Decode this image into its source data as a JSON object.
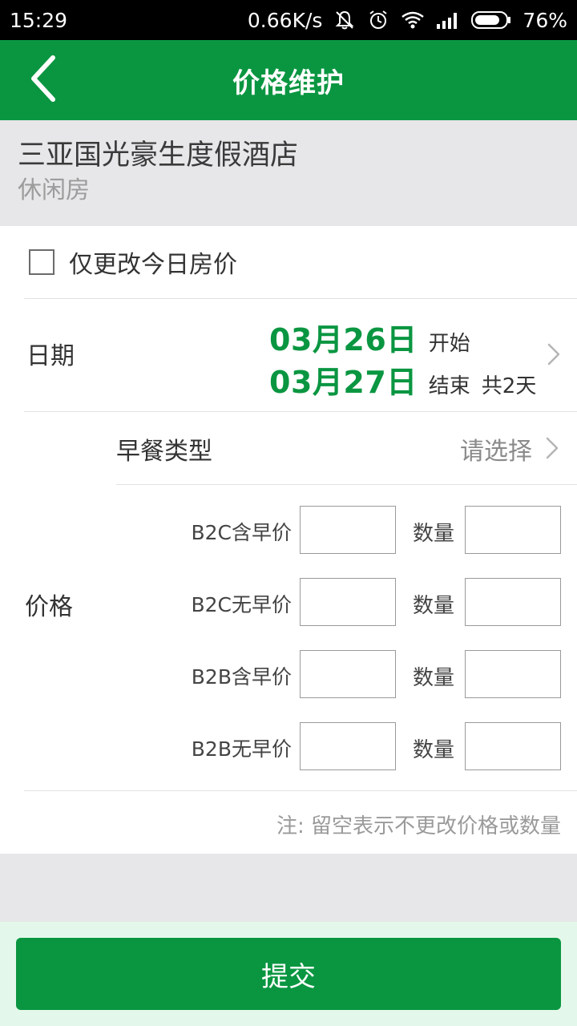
{
  "status_bar": {
    "time": "15:29",
    "speed": "0.66K/s",
    "battery": "76%"
  },
  "app_bar": {
    "title": "价格维护",
    "back_icon": "back-chevron-icon"
  },
  "hotel": {
    "name": "三亚国光豪生度假酒店",
    "room_type": "休闲房"
  },
  "today_only": {
    "label": "仅更改今日房价",
    "checked": false
  },
  "date": {
    "label": "日期",
    "start_date": "03月26日",
    "start_suffix": "开始",
    "end_date": "03月27日",
    "end_suffix": "结束",
    "total": "共2天"
  },
  "breakfast": {
    "label": "早餐类型",
    "placeholder": "请选择"
  },
  "price": {
    "label": "价格",
    "rows": [
      {
        "label": "B2C含早价",
        "qty_label": "数量",
        "price_value": "",
        "qty_value": ""
      },
      {
        "label": "B2C无早价",
        "qty_label": "数量",
        "price_value": "",
        "qty_value": ""
      },
      {
        "label": "B2B含早价",
        "qty_label": "数量",
        "price_value": "",
        "qty_value": ""
      },
      {
        "label": "B2B无早价",
        "qty_label": "数量",
        "price_value": "",
        "qty_value": ""
      }
    ]
  },
  "note": "注: 留空表示不更改价格或数量",
  "submit_label": "提交",
  "colors": {
    "brand_green": "#0a9641",
    "bottom_tint": "#e3f8ea",
    "page_bg": "#e7e6e8"
  }
}
